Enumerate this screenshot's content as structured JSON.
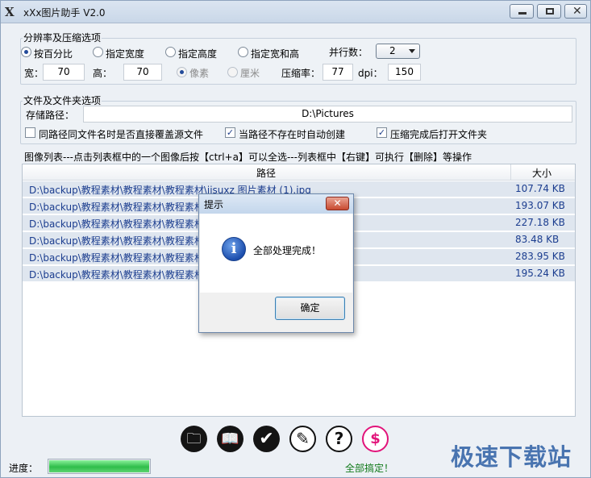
{
  "app": {
    "logo": "X",
    "title": "xXx图片助手 V2.0",
    "window_controls": {
      "minimize": "minimize",
      "maximize": "maximize",
      "close": "close"
    }
  },
  "resolution_group": {
    "title": "分辨率及压缩选项",
    "radio_options": [
      {
        "label": "按百分比",
        "checked": true
      },
      {
        "label": "指定宽度",
        "checked": false
      },
      {
        "label": "指定高度",
        "checked": false
      },
      {
        "label": "指定宽和高",
        "checked": false
      }
    ],
    "columns_label": "并行数：",
    "columns_value": "2",
    "width_label": "宽：",
    "width_value": "70",
    "height_label": "高：",
    "height_value": "70",
    "unit_options": [
      {
        "label": "像素",
        "checked": true,
        "disabled": true
      },
      {
        "label": "厘米",
        "checked": false,
        "disabled": true
      }
    ],
    "compression_label": "压缩率：",
    "compression_value": "77",
    "dpi_label": "dpi：",
    "dpi_value": "150"
  },
  "folder_group": {
    "title": "文件及文件夹选项",
    "path_label": "存储路径：",
    "path_value": "D:\\Pictures",
    "checkboxes": [
      {
        "label": "同路径同文件名时是否直接覆盖源文件",
        "checked": false
      },
      {
        "label": "当路径不存在时自动创建",
        "checked": true
      },
      {
        "label": "压缩完成后打开文件夹",
        "checked": true
      }
    ]
  },
  "image_list": {
    "hint": "图像列表---点击列表框中的一个图像后按【ctrl+a】可以全选---列表框中【右键】可执行【删除】等操作",
    "columns": [
      "路径",
      "大小"
    ],
    "rows": [
      {
        "path": "D:\\backup\\教程素材\\教程素材\\教程素材\\jisuxz 图片素材 (1).jpg",
        "size": "107.74 KB"
      },
      {
        "path": "D:\\backup\\教程素材\\教程素材\\教程素材",
        "size": "193.07 KB"
      },
      {
        "path": "D:\\backup\\教程素材\\教程素材\\教程素材",
        "size": "227.18 KB"
      },
      {
        "path": "D:\\backup\\教程素材\\教程素材\\教程素材",
        "size": "83.48 KB"
      },
      {
        "path": "D:\\backup\\教程素材\\教程素材\\教程素材",
        "size": "283.95 KB"
      },
      {
        "path": "D:\\backup\\教程素材\\教程素材\\教程素材",
        "size": "195.24 KB"
      }
    ]
  },
  "toolbar": {
    "buttons": [
      {
        "name": "folder-open-button",
        "icon": "folder-icon",
        "glyph": "🗀"
      },
      {
        "name": "book-button",
        "icon": "book-icon",
        "glyph": "📖"
      },
      {
        "name": "confirm-button",
        "icon": "checkmark-icon",
        "glyph": "✔"
      },
      {
        "name": "edit-button",
        "icon": "pencil-icon",
        "glyph": "✎"
      },
      {
        "name": "help-button",
        "icon": "question-icon",
        "glyph": "?"
      },
      {
        "name": "donate-button",
        "icon": "dollar-icon",
        "glyph": "$"
      }
    ]
  },
  "status": {
    "progress_label": "进度：",
    "progress_fraction": 1.0,
    "message": "全部搞定！"
  },
  "watermark": "极速下载站",
  "dialog": {
    "title": "提示",
    "close_glyph": "✕",
    "icon": "info-icon",
    "icon_glyph": "i",
    "message": "全部处理完成！",
    "ok_label": "确定"
  },
  "colors": {
    "progress_green": "#2fbd4a",
    "done_text": "#117a1a",
    "row_text": "#1b3d8f",
    "donate_pink": "#e2137a"
  }
}
